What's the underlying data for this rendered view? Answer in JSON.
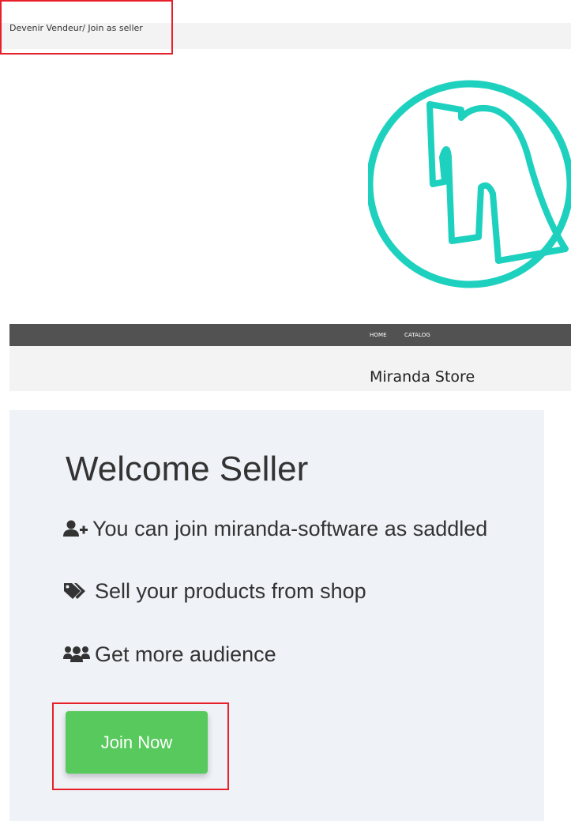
{
  "header": {
    "become_seller_link": "Devenir Vendeur/ Join as seller"
  },
  "logo": {
    "icon": "miranda-m-logo",
    "color": "#1ed1bf"
  },
  "nav": {
    "items": [
      {
        "label": "HOME"
      },
      {
        "label": "CATALOG"
      }
    ]
  },
  "store": {
    "name": "Miranda Store"
  },
  "welcome": {
    "title": "Welcome Seller",
    "features": [
      {
        "icon": "user-plus-icon",
        "text": "You can join miranda-software as saddled"
      },
      {
        "icon": "tags-icon",
        "text": "Sell your products from shop"
      },
      {
        "icon": "users-icon",
        "text": "Get more audience"
      }
    ],
    "join_button": "Join Now"
  },
  "colors": {
    "accent_green": "#58c95c",
    "navbar": "#525252",
    "annotation_red": "#e8202a",
    "panel_bg": "#eff2f7"
  }
}
